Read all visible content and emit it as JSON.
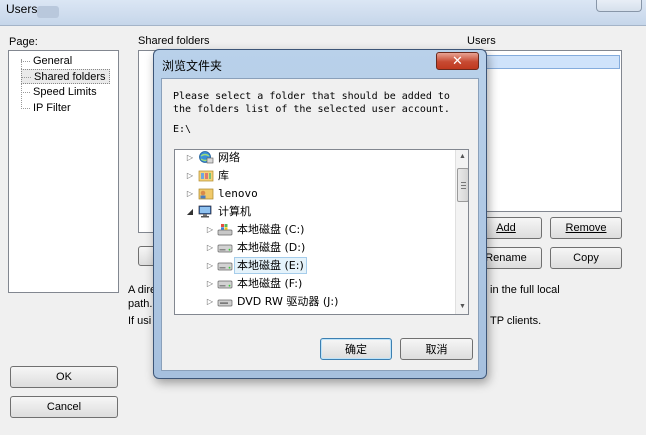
{
  "window": {
    "title": "Users"
  },
  "page_panel": {
    "label": "Page:",
    "items": [
      {
        "label": "General"
      },
      {
        "label": "Shared folders",
        "selected": true
      },
      {
        "label": "Speed Limits"
      },
      {
        "label": "IP Filter"
      }
    ]
  },
  "shared_folders": {
    "label": "Shared folders",
    "description_line1": "A dire",
    "description_line1_right": "in the full local",
    "description_line2": "path.",
    "description_line3": "If usi",
    "description_line3_right": "TP clients."
  },
  "users_panel": {
    "label": "Users",
    "add_label": "Add",
    "remove_label": "Remove",
    "rename_label": "Rename",
    "copy_label": "Copy"
  },
  "footer": {
    "ok_label": "OK",
    "cancel_label": "Cancel"
  },
  "browse_dialog": {
    "title": "浏览文件夹",
    "close_symbol": "✕",
    "instruction_line1": "Please select a folder that should be added to",
    "instruction_line2": "the folders list of the selected user account.",
    "current_path": "E:\\",
    "tree": [
      {
        "label": "网络",
        "icon": "network-icon",
        "expander": "collapsed"
      },
      {
        "label": "库",
        "icon": "library-icon",
        "expander": "collapsed"
      },
      {
        "label": "lenovo",
        "icon": "user-folder-icon",
        "expander": "collapsed"
      },
      {
        "label": "计算机",
        "icon": "computer-icon",
        "expander": "expanded"
      },
      {
        "label": "本地磁盘 (C:)",
        "icon": "system-drive-icon",
        "expander": "collapsed"
      },
      {
        "label": "本地磁盘 (D:)",
        "icon": "hard-drive-icon",
        "expander": "collapsed"
      },
      {
        "label": "本地磁盘 (E:)",
        "icon": "hard-drive-icon",
        "expander": "collapsed",
        "selected": true
      },
      {
        "label": "本地磁盘 (F:)",
        "icon": "hard-drive-icon",
        "expander": "collapsed"
      },
      {
        "label": "DVD RW 驱动器 (J:)",
        "icon": "dvd-drive-icon",
        "expander": "collapsed"
      }
    ],
    "ok_label": "确定",
    "cancel_label": "取消"
  },
  "colors": {
    "selection_bg": "#e5f3fb",
    "selection_border": "#a6cdeb",
    "dialog_frame": "#b9d1ea",
    "close_red": "#c74a32"
  }
}
